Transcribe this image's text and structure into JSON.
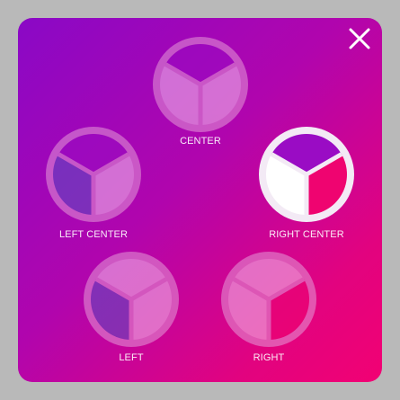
{
  "dialog": {
    "close_label": "close"
  },
  "positions": [
    {
      "id": "center",
      "label": "CENTER",
      "selected": false,
      "segments": {
        "top": "#9a0cc4",
        "left": "#f7c6f0",
        "right": "#f7c6f0"
      }
    },
    {
      "id": "left-center",
      "label": "LEFT CENTER",
      "selected": false,
      "segments": {
        "top": "#9a0cc4",
        "left": "#5a52c2",
        "right": "#f7c6f0"
      }
    },
    {
      "id": "right-center",
      "label": "RIGHT CENTER",
      "selected": true,
      "segments": {
        "top": "#9a0cc4",
        "left": "#ffffff",
        "right": "#ef0470"
      }
    },
    {
      "id": "left",
      "label": "LEFT",
      "selected": false,
      "segments": {
        "top": "#f7c6f0",
        "left": "#5a52c2",
        "right": "#f7c6f0"
      }
    },
    {
      "id": "right",
      "label": "RIGHT",
      "selected": false,
      "segments": {
        "top": "#f7c6f0",
        "left": "#f7c6f0",
        "right": "#ef0470"
      }
    }
  ],
  "colors": {
    "gradient_start": "#8a08c6",
    "gradient_end": "#f20173",
    "ring": "#f3eaf5",
    "divider": "#f3eaf5",
    "unselected_ring": "#e59ad8"
  }
}
